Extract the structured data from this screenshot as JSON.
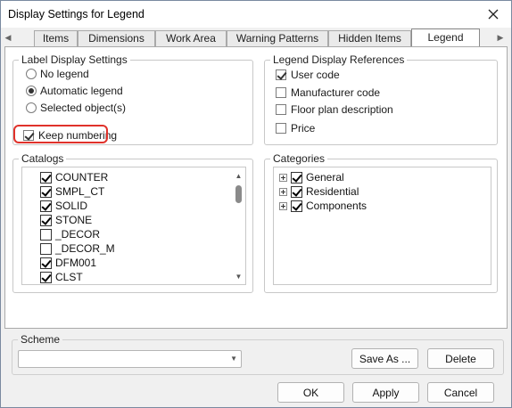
{
  "window": {
    "title": "Display Settings for Legend"
  },
  "tabs": [
    {
      "label": "Items"
    },
    {
      "label": "Dimensions"
    },
    {
      "label": "Work Area"
    },
    {
      "label": "Warning Patterns"
    },
    {
      "label": "Hidden Items"
    },
    {
      "label": "Legend",
      "active": true
    }
  ],
  "label_display": {
    "title": "Label Display Settings",
    "options": [
      {
        "label": "No legend",
        "selected": false
      },
      {
        "label": "Automatic legend",
        "selected": true
      },
      {
        "label": "Selected object(s)",
        "selected": false
      }
    ],
    "keep_numbering": {
      "label": "Keep numbering",
      "checked": true
    }
  },
  "legend_refs": {
    "title": "Legend Display References",
    "items": [
      {
        "label": "User code",
        "checked": true
      },
      {
        "label": "Manufacturer code",
        "checked": false
      },
      {
        "label": "Floor plan description",
        "checked": false
      },
      {
        "label": "Price",
        "checked": false
      }
    ]
  },
  "catalogs": {
    "title": "Catalogs",
    "items": [
      {
        "label": "COUNTER",
        "checked": true
      },
      {
        "label": "SMPL_CT",
        "checked": true
      },
      {
        "label": "SOLID",
        "checked": true
      },
      {
        "label": "STONE",
        "checked": true
      },
      {
        "label": "_DECOR",
        "checked": false
      },
      {
        "label": "_DECOR_M",
        "checked": false
      },
      {
        "label": "DFM001",
        "checked": true
      },
      {
        "label": "CLST",
        "checked": true
      }
    ]
  },
  "categories": {
    "title": "Categories",
    "items": [
      {
        "label": "General",
        "checked": true
      },
      {
        "label": "Residential",
        "checked": true
      },
      {
        "label": "Components",
        "checked": true
      }
    ]
  },
  "scheme": {
    "title": "Scheme",
    "value": "",
    "save_as_label": "Save As ...",
    "delete_label": "Delete"
  },
  "footer": {
    "ok_label": "OK",
    "apply_label": "Apply",
    "cancel_label": "Cancel"
  },
  "colors": {
    "highlight": "#e0322b"
  }
}
